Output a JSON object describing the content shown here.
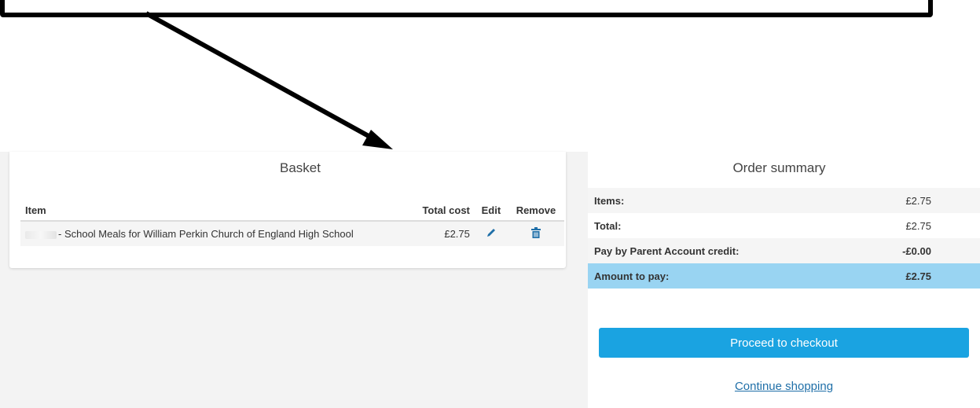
{
  "basket": {
    "title": "Basket",
    "columns": {
      "item": "Item",
      "total_cost": "Total cost",
      "edit": "Edit",
      "remove": "Remove"
    },
    "rows": [
      {
        "item": "- School Meals for William Perkin Church of England High School",
        "total_cost": "£2.75"
      }
    ]
  },
  "summary": {
    "title": "Order summary",
    "rows": [
      {
        "label": "Items:",
        "value": "£2.75"
      },
      {
        "label": "Total:",
        "value": "£2.75"
      },
      {
        "label": "Pay by Parent Account credit:",
        "value": "-£0.00"
      },
      {
        "label": "Amount to pay:",
        "value": "£2.75"
      }
    ],
    "row_colors": [
      "#f5f5f5",
      "#ffffff",
      "#f5f5f5",
      "#99d4f2"
    ],
    "checkout_label": "Proceed to checkout",
    "continue_label": "Continue shopping"
  },
  "colors": {
    "accent": "#1aa3e1",
    "highlight_row": "#99d4f2",
    "icon": "#1f6fa8"
  },
  "icons": [
    "edit-pencil-icon",
    "trash-icon",
    "annotation-arrow-icon"
  ]
}
